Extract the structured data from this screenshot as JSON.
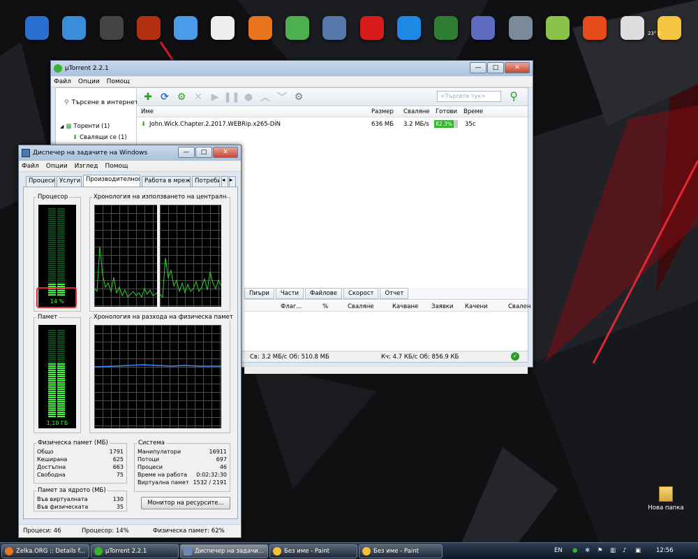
{
  "dock": {
    "icons": [
      "windows-icon",
      "monitor-icon",
      "media-center-icon",
      "shelf-icon",
      "folder-icon",
      "skull-icon",
      "firefox-icon",
      "kmplayer-icon",
      "satellite-icon",
      "mega-icon",
      "teamviewer-icon",
      "resource-monitor-icon",
      "star-icon",
      "recycle-bin-icon",
      "lime-icon",
      "power-icon",
      "eye-icon",
      "weather-icon"
    ],
    "weather": "23° C"
  },
  "utorrent": {
    "title": "µTorrent 2.2.1",
    "menu": [
      "Файл",
      "Опции",
      "Помощ"
    ],
    "sidebar": {
      "search": "Търсене в интернет",
      "torrents": "Торенти (1)",
      "downloading": "Свалящи се (1)"
    },
    "search_placeholder": "<Търсете тук>",
    "columns": {
      "name": "Име",
      "size": "Размер",
      "down": "Сваляне",
      "done": "Готови",
      "time": "Време"
    },
    "row": {
      "name": "John.Wick.Chapter.2.2017.WEBRip.x265-DiN",
      "size": "636 МБ",
      "down": "3.2 МБ/s",
      "done": "82.3%",
      "done_value": 0.823,
      "time": "35с"
    },
    "tabs": [
      "Пиъри",
      "Части",
      "Файлове",
      "Скорост",
      "Отчет"
    ],
    "peer_columns": [
      "Флаг...",
      "%",
      "Сваляне",
      "Качване",
      "Заявки",
      "Качени",
      "Свален"
    ],
    "status_down": "Св: 3.2 МБ/с Об: 510.8 МБ",
    "status_up": "Кч: 4.7 КБ/с Об: 856.9 КБ"
  },
  "taskmgr": {
    "title": "Диспечер на задачите на Windows",
    "menu": [
      "Файл",
      "Опции",
      "Изглед",
      "Помощ"
    ],
    "tabs": [
      "Процеси",
      "Услуги",
      "Производителност",
      "Работа в мрежа",
      "Потреби"
    ],
    "cpu_label": "Процесор",
    "cpu_value": "14 %",
    "cpu_fraction": 0.14,
    "cpu_history_label": "Хронология на използването на централния пр",
    "mem_label": "Памет",
    "mem_value": "1,10 ГБ",
    "mem_fraction": 0.62,
    "mem_history_label": "Хронология на разхода на физическа памет",
    "physical": {
      "title": "Физическа памет (МБ)",
      "rows": [
        [
          "Общо",
          "1791"
        ],
        [
          "Кеширана",
          "625"
        ],
        [
          "Достъпна",
          "663"
        ],
        [
          "Свободна",
          "75"
        ]
      ]
    },
    "kernel": {
      "title": "Памет за ядрото (МБ)",
      "rows": [
        [
          "Във виртуалната",
          "130"
        ],
        [
          "Във физическата",
          "35"
        ]
      ]
    },
    "system": {
      "title": "Система",
      "rows": [
        [
          "Манипулатори",
          "16911"
        ],
        [
          "Потоци",
          "697"
        ],
        [
          "Процеси",
          "46"
        ],
        [
          "Време на работа",
          "0:02:32:30"
        ],
        [
          "Виртуална памет",
          "1532 / 2191"
        ]
      ]
    },
    "resource_button": "Монитор на ресурсите...",
    "status": {
      "processes": "Процеси: 46",
      "cpu": "Процесор: 14%",
      "memory": "Физическа памет: 62%"
    }
  },
  "desktop": {
    "folder_label": "Нова папка"
  },
  "taskbar": {
    "buttons": [
      "Zelka.ORG :: Details f...",
      "µTorrent 2.2.1",
      "Диспечер на задачи...",
      "Без име - Paint",
      "Без име - Paint"
    ],
    "lang": "EN",
    "clock": "12:56"
  },
  "colors": {
    "accent": "#37b42d",
    "graph": "#2bd62b",
    "highlight": "#e0282e"
  }
}
